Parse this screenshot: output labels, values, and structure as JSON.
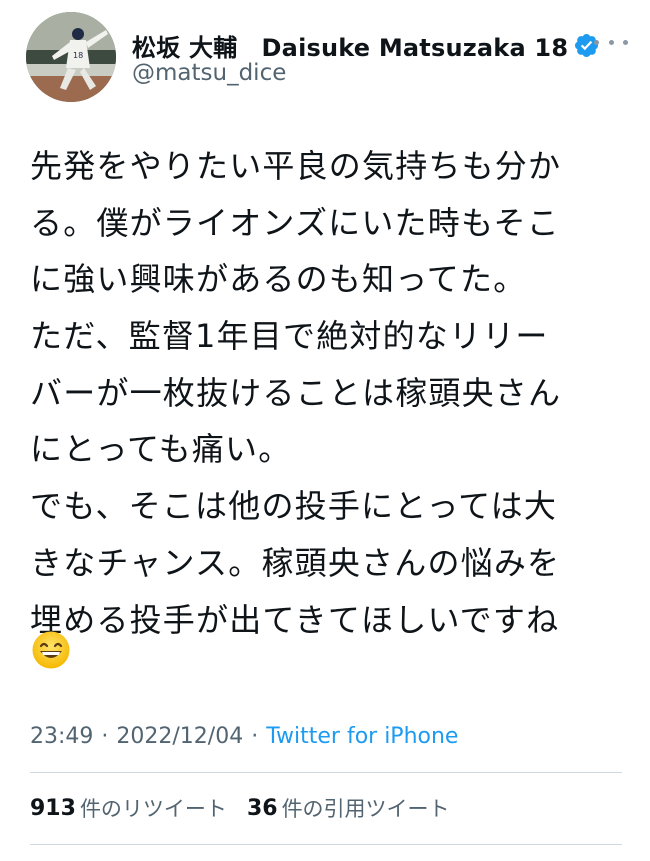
{
  "author": {
    "display_name": "松坂 大輔　Daisuke Matsuzaka 18",
    "handle": "@matsu_dice",
    "verified": true,
    "avatar_icon": "avatar-photo-pitcher",
    "verified_icon": "verified-badge-icon",
    "more_icon": "more-options-icon"
  },
  "tweet": {
    "lines": [
      "先発をやりたい平良の気持ちも分か",
      "る。僕がライオンズにいた時もそこ",
      "に強い興味があるのも知ってた。",
      "ただ、監督1年目で絶対的なリリー",
      "バーが一枚抜けることは稼頭央さん",
      "にとっても痛い。",
      "でも、そこは他の投手にとっては大",
      "きなチャンス。稼頭央さんの悩みを",
      "埋める投手が出てきてほしいですね"
    ],
    "emoji": "😄",
    "emoji_name": "grinning-face-emoji"
  },
  "meta": {
    "time": "23:49",
    "separator": "·",
    "date": "2022/12/04",
    "source": "Twitter for iPhone"
  },
  "stats": {
    "retweets_count": "913",
    "retweets_label": "件のリツイート",
    "quotes_count": "36",
    "quotes_label": "件の引用ツイート"
  },
  "colors": {
    "text": "#0f1419",
    "secondary": "#536471",
    "link": "#1d9bf0",
    "verified": "#1d9bf0",
    "divider": "#cfd9de"
  }
}
